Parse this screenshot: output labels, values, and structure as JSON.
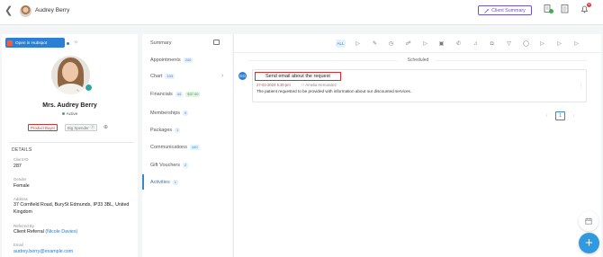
{
  "header": {
    "back_glyph": "❮",
    "client_name": "Audrey Berry",
    "client_summary_label": "Client Summary",
    "notification_count": "9"
  },
  "profile": {
    "hubspot_label": "Open in Hubspot",
    "name": "Mrs. Audrey Berry",
    "status": "Active",
    "tags": [
      "Product Buyer",
      "Big Spender"
    ],
    "details_title": "DETAILS",
    "fields": {
      "client_id_label": "Client ID",
      "client_id": "287",
      "gender_label": "Gender",
      "gender": "Female",
      "address_label": "Address",
      "address": "37 Cornfield Road, BurySt Edmunds, IP33 3BL, United Kingdom",
      "referred_by_label": "Referred By",
      "referred_by": "Client Referral",
      "referrer": "(Nicole Davies)",
      "email_label": "Email",
      "email": "audrey.berry@example.com"
    }
  },
  "nav": {
    "items": [
      {
        "label": "Summary",
        "count": ""
      },
      {
        "label": "Appointments",
        "count": "240"
      },
      {
        "label": "Chart",
        "count": "103"
      },
      {
        "label": "Financials",
        "count": "44",
        "amount": "$37.00"
      },
      {
        "label": "Memberships",
        "count": "0"
      },
      {
        "label": "Packages",
        "count": "1"
      },
      {
        "label": "Communications",
        "count": "440"
      },
      {
        "label": "Gift Vouchers",
        "count": "2"
      },
      {
        "label": "Activities",
        "count": "1"
      }
    ]
  },
  "activities": {
    "toolbar_active_label": "ALL",
    "section_label": "Scheduled",
    "card": {
      "icon_label": "GO",
      "title": "Send email about the request",
      "date": "27-02-2024 5:30 pm",
      "assignee": "Amelia Hernandez",
      "body": "The patient requested to be provided with information about our discounted services."
    },
    "page": "1"
  },
  "colors": {
    "accent_purple": "#6b54c9",
    "hubspot_blue": "#2d7fd4",
    "tag_red": "#c93838",
    "highlight_red": "#d92d2d",
    "fab_blue": "#2f9ae0"
  }
}
